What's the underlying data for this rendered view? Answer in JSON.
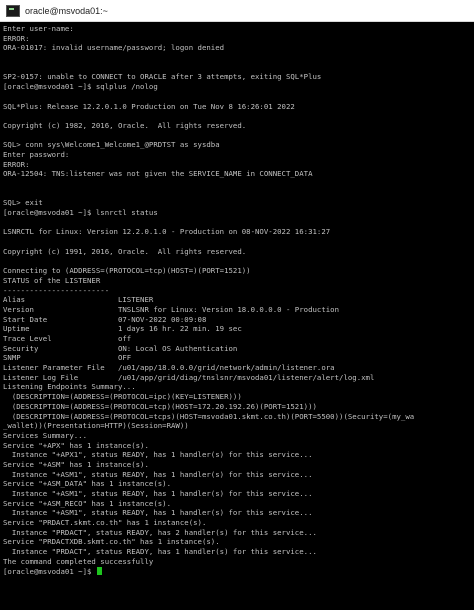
{
  "window": {
    "title": "oracle@msvoda01:~"
  },
  "terminal": {
    "colors": {
      "background": "#000000",
      "foreground": "#c0c0c0",
      "cursor": "#1ec51e"
    },
    "lines": [
      "Enter user-name:",
      "ERROR:",
      "ORA-01017: invalid username/password; logon denied",
      "",
      "",
      "SP2-0157: unable to CONNECT to ORACLE after 3 attempts, exiting SQL*Plus",
      "[oracle@msvoda01 ~]$ sqlplus /nolog",
      "",
      "SQL*Plus: Release 12.2.0.1.0 Production on Tue Nov 8 16:26:01 2022",
      "",
      "Copyright (c) 1982, 2016, Oracle.  All rights reserved.",
      "",
      "SQL> conn sys\\Welcome1_Welcome1_@PRDTST as sysdba",
      "Enter password:",
      "ERROR:",
      "ORA-12504: TNS:listener was not given the SERVICE_NAME in CONNECT_DATA",
      "",
      "",
      "SQL> exit",
      "[oracle@msvoda01 ~]$ lsnrctl status",
      "",
      "LSNRCTL for Linux: Version 12.2.0.1.0 - Production on 08-NOV-2022 16:31:27",
      "",
      "Copyright (c) 1991, 2016, Oracle.  All rights reserved.",
      "",
      "Connecting to (ADDRESS=(PROTOCOL=tcp)(HOST=)(PORT=1521))",
      "STATUS of the LISTENER",
      "------------------------",
      "Alias                     LISTENER",
      "Version                   TNSLSNR for Linux: Version 18.0.0.0.0 - Production",
      "Start Date                07-NOV-2022 00:09:08",
      "Uptime                    1 days 16 hr. 22 min. 19 sec",
      "Trace Level               off",
      "Security                  ON: Local OS Authentication",
      "SNMP                      OFF",
      "Listener Parameter File   /u01/app/18.0.0.0/grid/network/admin/listener.ora",
      "Listener Log File         /u01/app/grid/diag/tnslsnr/msvoda01/listener/alert/log.xml",
      "Listening Endpoints Summary...",
      "  (DESCRIPTION=(ADDRESS=(PROTOCOL=ipc)(KEY=LISTENER)))",
      "  (DESCRIPTION=(ADDRESS=(PROTOCOL=tcp)(HOST=172.20.192.26)(PORT=1521)))",
      "  (DESCRIPTION=(ADDRESS=(PROTOCOL=tcps)(HOST=msvoda01.skmt.co.th)(PORT=5500))(Security=(my_wa",
      "_wallet))(Presentation=HTTP)(Session=RAW))",
      "Services Summary...",
      "Service \"+APX\" has 1 instance(s).",
      "  Instance \"+APX1\", status READY, has 1 handler(s) for this service...",
      "Service \"+ASM\" has 1 instance(s).",
      "  Instance \"+ASM1\", status READY, has 1 handler(s) for this service...",
      "Service \"+ASM_DATA\" has 1 instance(s).",
      "  Instance \"+ASM1\", status READY, has 1 handler(s) for this service...",
      "Service \"+ASM_RECO\" has 1 instance(s).",
      "  Instance \"+ASM1\", status READY, has 1 handler(s) for this service...",
      "Service \"PRDACT.skmt.co.th\" has 1 instance(s).",
      "  Instance \"PRDACT\", status READY, has 2 handler(s) for this service...",
      "Service \"PRDACTXDB.skmt.co.th\" has 1 instance(s).",
      "  Instance \"PRDACT\", status READY, has 1 handler(s) for this service...",
      "The command completed successfully"
    ],
    "prompt": "[oracle@msvoda01 ~]$ "
  }
}
